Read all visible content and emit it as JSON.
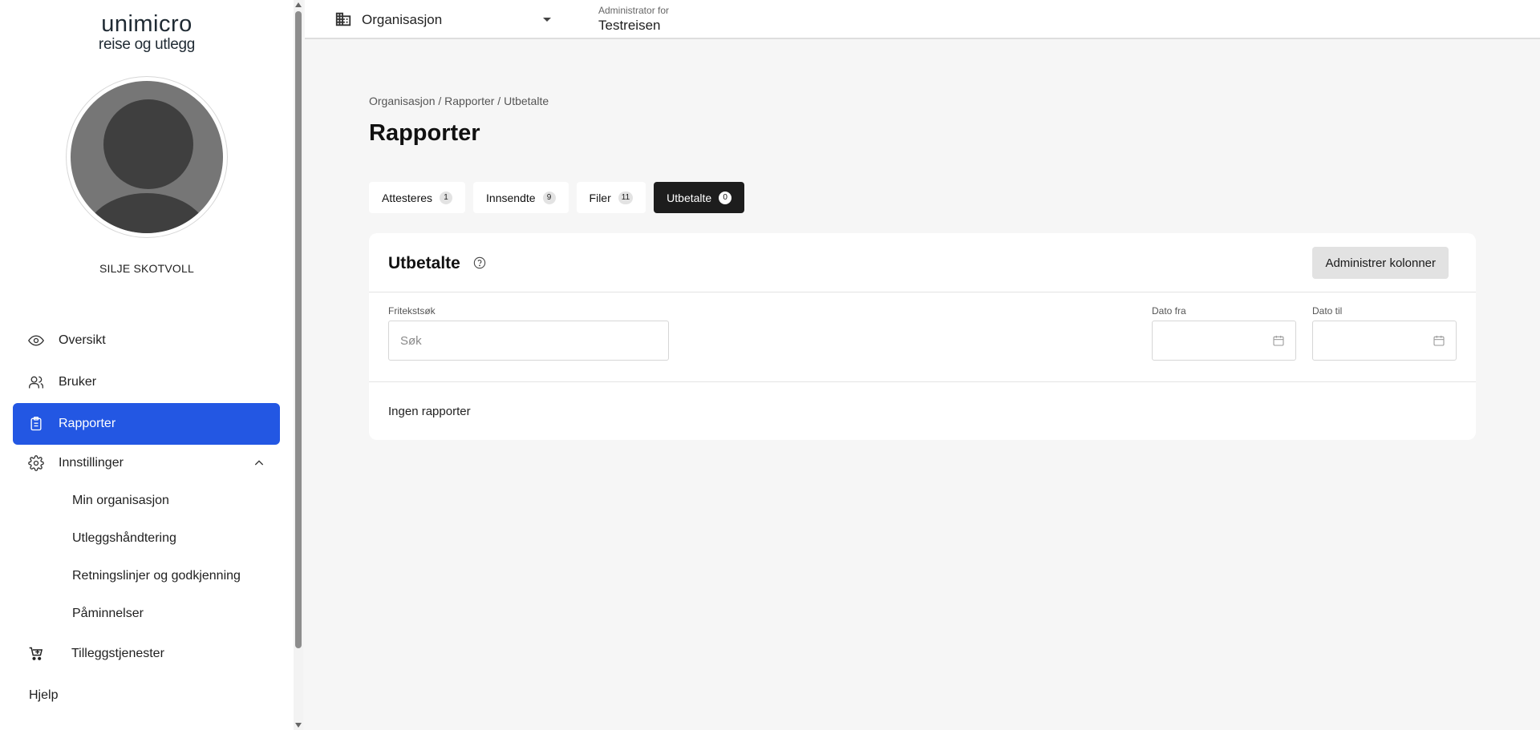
{
  "brand": {
    "line1": "unimicro",
    "line2": "reise og utlegg"
  },
  "user": {
    "name": "SILJE SKOTVOLL"
  },
  "sidebar": {
    "items": [
      {
        "label": "Oversikt",
        "icon": "eye-icon"
      },
      {
        "label": "Bruker",
        "icon": "users-icon"
      },
      {
        "label": "Rapporter",
        "icon": "clipboard-icon",
        "active": true
      },
      {
        "label": "Innstillinger",
        "icon": "gear-icon"
      }
    ],
    "subitems": [
      {
        "label": "Min organisasjon"
      },
      {
        "label": "Utleggshåndtering"
      },
      {
        "label": "Retningslinjer og godkjenning"
      },
      {
        "label": "Påminnelser"
      }
    ],
    "extra": {
      "label": "Tilleggstjenester",
      "icon": "cart-plus-icon"
    },
    "help": {
      "label": "Hjelp"
    }
  },
  "topbar": {
    "org_label": "Organisasjon",
    "admin_for_label": "Administrator for",
    "admin_for_value": "Testreisen"
  },
  "main": {
    "breadcrumb": "Organisasjon / Rapporter / Utbetalte",
    "title": "Rapporter",
    "tabs": [
      {
        "label": "Attesteres",
        "count": "1"
      },
      {
        "label": "Innsendte",
        "count": "9"
      },
      {
        "label": "Filer",
        "count": "11"
      },
      {
        "label": "Utbetalte",
        "count": "0",
        "active": true
      }
    ],
    "card": {
      "title": "Utbetalte",
      "manage_columns": "Administrer kolonner",
      "search_label": "Fritekstsøk",
      "search_placeholder": "Søk",
      "date_from_label": "Dato fra",
      "date_to_label": "Dato til",
      "empty_text": "Ingen rapporter"
    }
  },
  "colors": {
    "accent": "#2357e3",
    "active_tab": "#1d1d1d"
  }
}
